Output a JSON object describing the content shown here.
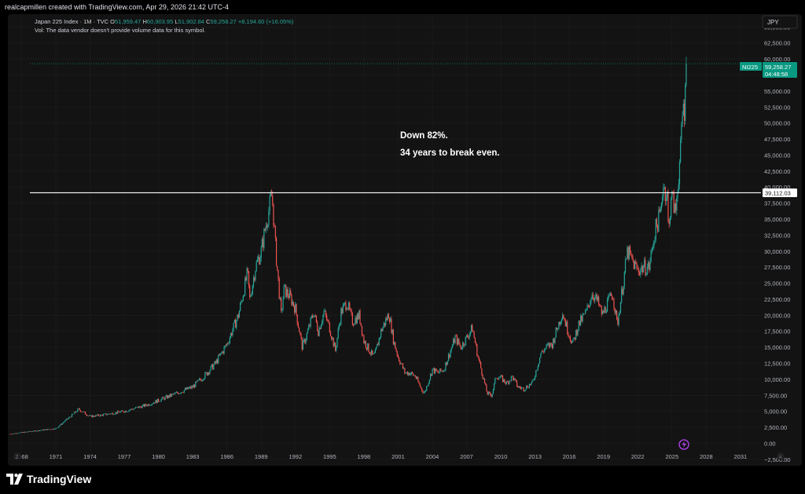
{
  "header": {
    "attribution": "realcapmillen created with TradingView.com, Apr 29, 2026 21:42 UTC-4"
  },
  "legend": {
    "symbol_line": "Japan 225 Index · 1M · TVC",
    "ohlc": [
      {
        "label": "O",
        "value": "51,959.47"
      },
      {
        "label": "H",
        "value": "60,903.95"
      },
      {
        "label": "L",
        "value": "51,902.84"
      },
      {
        "label": "C",
        "value": "59,258.27"
      }
    ],
    "change": "+8,194.60 (+16.05%)",
    "vol_note": "Vol: The data vendor doesn't provide volume data for this symbol."
  },
  "currency_button": "JPY",
  "annotations": [
    "Down 82%.",
    "34 years to break even."
  ],
  "price_badge": {
    "symbol": "NI225",
    "price": "59,258.27",
    "countdown": "04:48:58"
  },
  "hline_label": "39,112.03",
  "corner_left": "Z",
  "corner_right": "A",
  "footer": {
    "logo_text": "TradingView"
  },
  "colors": {
    "up": "#26a69a",
    "down": "#ef5350",
    "badge": "#089981",
    "hline": "#ffffff",
    "accent": "#b543f5"
  },
  "chart_data": {
    "type": "candlestick",
    "interval": "1M",
    "currency": "JPY",
    "ylim": [
      -3500,
      67000
    ],
    "xlim": [
      1966.8,
      2032.8
    ],
    "y_ticks": [
      65000,
      62500,
      60000,
      57500,
      55000,
      52500,
      50000,
      47500,
      45000,
      42500,
      40000,
      37500,
      35000,
      32500,
      30000,
      27500,
      25000,
      22500,
      20000,
      17500,
      15000,
      12500,
      10000,
      7500,
      5000,
      2500,
      0,
      -2500
    ],
    "y_tick_labels": [
      "65,000.00",
      "62,500.00",
      "60,000.00",
      "57,500.00",
      "55,000.00",
      "52,500.00",
      "50,000.00",
      "47,500.00",
      "45,000.00",
      "42,500.00",
      "40,000.00",
      "37,500.00",
      "35,000.00",
      "32,500.00",
      "30,000.00",
      "27,500.00",
      "25,000.00",
      "22,500.00",
      "20,000.00",
      "17,500.00",
      "15,000.00",
      "12,500.00",
      "10,000.00",
      "7,500.00",
      "5,000.00",
      "2,500.00",
      "0.00",
      "−2,500.00"
    ],
    "x_ticks": [
      1968,
      1971,
      1974,
      1977,
      1980,
      1983,
      1986,
      1989,
      1992,
      1995,
      1998,
      2001,
      2004,
      2007,
      2010,
      2013,
      2016,
      2019,
      2022,
      2025,
      2028,
      2031
    ],
    "x_tick_labels": [
      "1968",
      "1971",
      "1974",
      "1977",
      "1980",
      "1983",
      "1986",
      "1989",
      "1992",
      "1995",
      "1998",
      "2001",
      "2004",
      "2007",
      "2010",
      "2013",
      "2016",
      "2019",
      "2022",
      "2025",
      "2028",
      "2031"
    ],
    "horizontal_line": 39112.03,
    "last_close": 59258.27,
    "path_points": [
      [
        1967.0,
        1450
      ],
      [
        1969.0,
        1900
      ],
      [
        1971.0,
        2300
      ],
      [
        1972.5,
        4500
      ],
      [
        1973.0,
        5300
      ],
      [
        1974.0,
        4200
      ],
      [
        1975.0,
        4400
      ],
      [
        1977.0,
        5000
      ],
      [
        1979.0,
        6000
      ],
      [
        1981.0,
        7400
      ],
      [
        1983.0,
        8800
      ],
      [
        1984.0,
        10500
      ],
      [
        1985.0,
        12500
      ],
      [
        1986.0,
        15500
      ],
      [
        1987.0,
        20000
      ],
      [
        1987.8,
        26600
      ],
      [
        1988.0,
        22500
      ],
      [
        1988.5,
        27500
      ],
      [
        1989.0,
        30000
      ],
      [
        1989.4,
        34000
      ],
      [
        1989.95,
        38900
      ],
      [
        1990.3,
        29500
      ],
      [
        1990.75,
        20000
      ],
      [
        1991.0,
        24000
      ],
      [
        1991.5,
        23000
      ],
      [
        1992.0,
        21000
      ],
      [
        1992.6,
        15000
      ],
      [
        1993.0,
        17000
      ],
      [
        1993.6,
        20500
      ],
      [
        1994.0,
        17500
      ],
      [
        1994.5,
        20500
      ],
      [
        1995.0,
        18000
      ],
      [
        1995.5,
        14500
      ],
      [
        1996.0,
        20500
      ],
      [
        1996.5,
        22000
      ],
      [
        1997.0,
        19000
      ],
      [
        1997.6,
        20000
      ],
      [
        1998.0,
        16000
      ],
      [
        1998.8,
        13500
      ],
      [
        1999.0,
        14000
      ],
      [
        1999.5,
        17500
      ],
      [
        2000.2,
        20300
      ],
      [
        2000.6,
        16000
      ],
      [
        2001.0,
        13500
      ],
      [
        2001.6,
        11000
      ],
      [
        2002.0,
        11000
      ],
      [
        2002.5,
        10500
      ],
      [
        2003.0,
        8600
      ],
      [
        2003.3,
        7800
      ],
      [
        2004.0,
        11500
      ],
      [
        2004.5,
        11000
      ],
      [
        2005.0,
        11500
      ],
      [
        2006.0,
        16500
      ],
      [
        2006.5,
        15000
      ],
      [
        2007.5,
        18000
      ],
      [
        2008.0,
        13500
      ],
      [
        2008.8,
        7800
      ],
      [
        2009.2,
        7500
      ],
      [
        2009.6,
        10500
      ],
      [
        2010.0,
        10200
      ],
      [
        2010.5,
        9400
      ],
      [
        2011.0,
        10400
      ],
      [
        2011.5,
        8800
      ],
      [
        2012.0,
        8500
      ],
      [
        2012.8,
        9500
      ],
      [
        2013.5,
        14000
      ],
      [
        2014.0,
        15000
      ],
      [
        2014.5,
        15500
      ],
      [
        2015.4,
        20500
      ],
      [
        2015.8,
        18000
      ],
      [
        2016.3,
        15500
      ],
      [
        2016.8,
        18500
      ],
      [
        2017.5,
        20500
      ],
      [
        2018.0,
        23500
      ],
      [
        2018.5,
        22000
      ],
      [
        2018.9,
        20000
      ],
      [
        2019.0,
        20500
      ],
      [
        2019.8,
        23500
      ],
      [
        2020.2,
        18500
      ],
      [
        2020.8,
        26000
      ],
      [
        2021.1,
        30000
      ],
      [
        2021.5,
        28500
      ],
      [
        2022.0,
        27000
      ],
      [
        2022.5,
        27500
      ],
      [
        2023.0,
        27500
      ],
      [
        2023.5,
        33000
      ],
      [
        2024.0,
        36000
      ],
      [
        2024.2,
        40500
      ],
      [
        2024.6,
        38500
      ],
      [
        2024.7,
        32000
      ],
      [
        2024.9,
        39000
      ],
      [
        2025.2,
        37000
      ],
      [
        2025.3,
        35500
      ],
      [
        2025.5,
        40500
      ],
      [
        2025.75,
        45500
      ],
      [
        2025.9,
        50500
      ],
      [
        2026.0,
        53000
      ],
      [
        2026.1,
        52000
      ],
      [
        2026.3,
        59258
      ]
    ]
  }
}
